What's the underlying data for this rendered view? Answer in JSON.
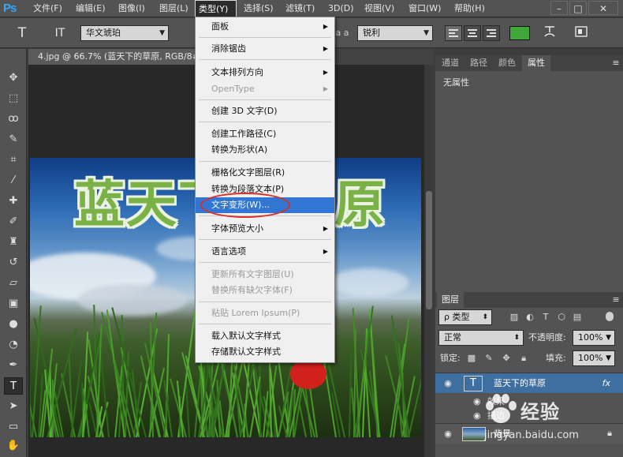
{
  "app": {
    "logo": "Ps"
  },
  "menubar": {
    "items": [
      "文件(F)",
      "编辑(E)",
      "图像(I)",
      "图层(L)",
      "类型(Y)",
      "选择(S)",
      "滤镜(T)",
      "3D(D)",
      "视图(V)",
      "窗口(W)",
      "帮助(H)"
    ],
    "active": "类型(Y)",
    "window_buttons": [
      "–",
      "□",
      "✕"
    ]
  },
  "options_bar": {
    "tool_icon": "T",
    "orientation_icon": "IT",
    "font_family": "华文琥珀",
    "aa_prefix": "a a",
    "antialias": "锐利"
  },
  "document": {
    "tab_title": "4.jpg @ 66.7% (蓝天下的草原, RGB/8#",
    "headline": "蓝天下的草原"
  },
  "type_menu": {
    "items": [
      {
        "label": "面板",
        "submenu": true,
        "disabled": false
      },
      {
        "label": "消除锯齿",
        "submenu": true,
        "disabled": false
      },
      {
        "label": "文本排列方向",
        "submenu": true,
        "disabled": false
      },
      {
        "label": "OpenType",
        "submenu": true,
        "disabled": true
      },
      {
        "label": "创建 3D 文字(D)",
        "submenu": false,
        "disabled": false
      },
      {
        "label": "创建工作路径(C)",
        "submenu": false,
        "disabled": false
      },
      {
        "label": "转换为形状(A)",
        "submenu": false,
        "disabled": false
      },
      {
        "label": "栅格化文字图层(R)",
        "submenu": false,
        "disabled": false
      },
      {
        "label": "转换为段落文本(P)",
        "submenu": false,
        "disabled": false
      },
      {
        "label": "文字变形(W)...",
        "submenu": false,
        "disabled": false,
        "highlighted": true
      },
      {
        "label": "字体预览大小",
        "submenu": true,
        "disabled": false
      },
      {
        "label": "语言选项",
        "submenu": true,
        "disabled": false
      },
      {
        "label": "更新所有文字图层(U)",
        "submenu": false,
        "disabled": true
      },
      {
        "label": "替换所有缺欠字体(F)",
        "submenu": false,
        "disabled": true
      },
      {
        "label": "粘贴 Lorem Ipsum(P)",
        "submenu": false,
        "disabled": true
      },
      {
        "label": "载入默认文字样式",
        "submenu": false,
        "disabled": false
      },
      {
        "label": "存储默认文字样式",
        "submenu": false,
        "disabled": false
      }
    ],
    "highlight_color": "#3176d3"
  },
  "properties_panel": {
    "tabs": [
      "通道",
      "路径",
      "颜色",
      "属性"
    ],
    "active_tab": "属性",
    "body": "无属性"
  },
  "layers_panel": {
    "tab": "图层",
    "filter_kind": "ρ 类型",
    "blend_mode": "正常",
    "opacity_label": "不透明度:",
    "opacity_value": "100%",
    "lock_label": "锁定:",
    "fill_label": "填充:",
    "fill_value": "100%",
    "layers": [
      {
        "name": "蓝天下的草原",
        "type": "text",
        "fx": "fx",
        "selected": true
      },
      {
        "name": "背景",
        "type": "image",
        "locked": true
      }
    ],
    "effects_label": "效果",
    "effect_item": "描边"
  },
  "watermark": {
    "brand": "经验",
    "url": "jingyan.baidu.com"
  },
  "colors": {
    "accent": "#31a8ff",
    "text_fill": "#7ab248",
    "swatch": "#3fa63a",
    "annotation": "#d8312a"
  }
}
